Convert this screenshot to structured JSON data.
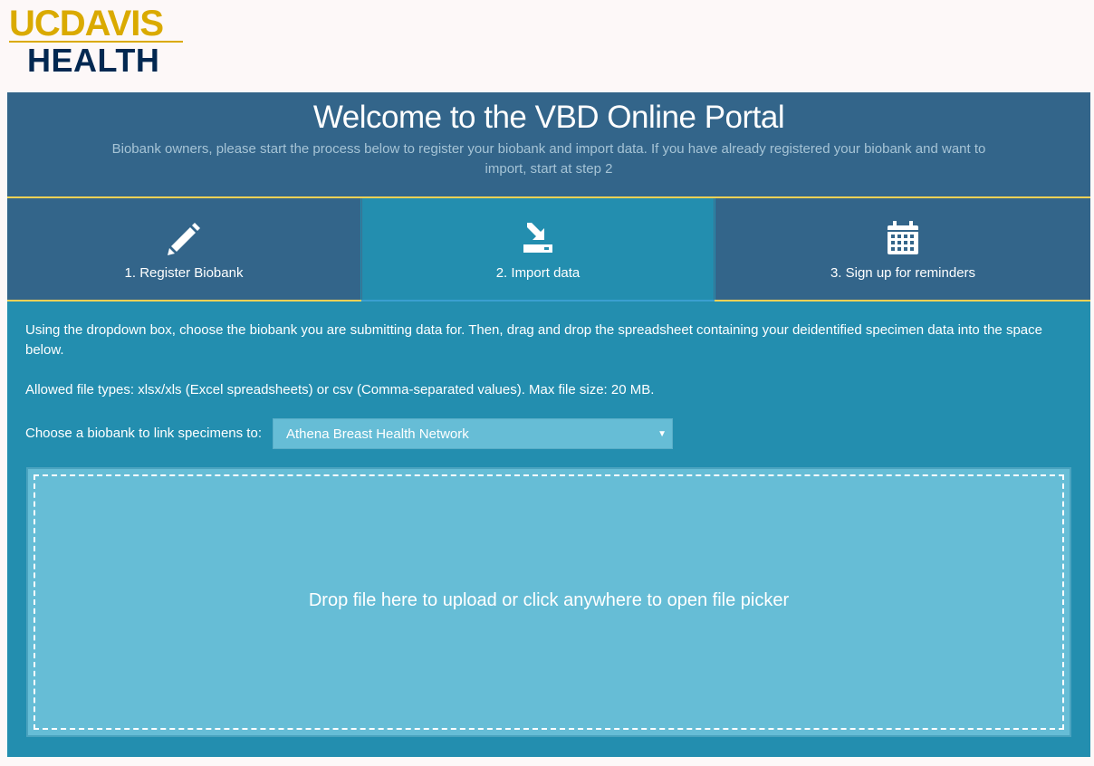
{
  "logo": {
    "line1": "UCDAVIS",
    "line2": "HEALTH"
  },
  "header": {
    "title": "Welcome to the VBD Online Portal",
    "subtitle": "Biobank owners, please start the process below to register your biobank and import data. If you have already registered your biobank and want to import, start at step 2"
  },
  "tabs": [
    {
      "label": "1. Register Biobank",
      "icon": "pencil-icon"
    },
    {
      "label": "2. Import data",
      "icon": "import-icon"
    },
    {
      "label": "3. Sign up for reminders",
      "icon": "calendar-icon"
    }
  ],
  "import": {
    "instructions": "Using the dropdown box, choose the biobank you are submitting data for. Then, drag and drop the spreadsheet containing your deidentified specimen data into the space below.",
    "file_types": "Allowed file types: xlsx/xls (Excel spreadsheets) or csv (Comma-separated values). Max file size: 20 MB.",
    "choose_label": "Choose a biobank to link specimens to:",
    "selected_biobank": "Athena Breast Health Network",
    "dropzone_text": "Drop file here to upload or click anywhere to open file picker"
  },
  "colors": {
    "header_bg": "#33658a",
    "active_bg": "#238eaf",
    "gold": "#f6d155",
    "dropzone_bg": "#66bdd6"
  }
}
